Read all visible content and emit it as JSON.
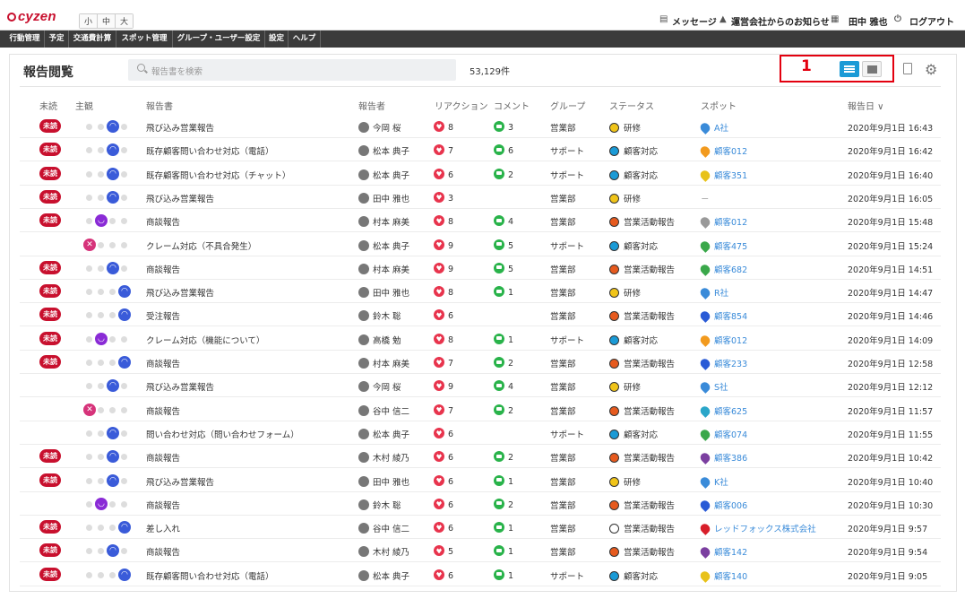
{
  "app": {
    "logo": "cyzen",
    "font_sizes": [
      "小",
      "中",
      "大"
    ]
  },
  "topright": {
    "message": "メッセージ",
    "notice": "運営会社からのお知らせ",
    "user": "田中 雅也",
    "logout": "ログアウト"
  },
  "nav": [
    "行動管理",
    "予定",
    "交通費計算",
    "スポット管理",
    "グループ・ユーザー設定",
    "設定",
    "ヘルプ"
  ],
  "page": {
    "title": "報告閲覧",
    "search_placeholder": "報告書を検索",
    "count": "53,129件",
    "annotation": "1"
  },
  "columns": [
    "未読",
    "主観",
    "報告書",
    "報告者",
    "リアクション",
    "コメント",
    "グループ",
    "ステータス",
    "スポット",
    "報告日 ∨"
  ],
  "colors": {
    "brand": "#c8102e",
    "accent": "#1a9ad6",
    "reaction": "#e8344d",
    "comment": "#29b34a",
    "link": "#3a8bd9"
  },
  "rows": [
    {
      "unread": "未読",
      "mood": "happy",
      "title": "飛び込み営業報告",
      "reporter": "今岡 桜",
      "reaction": "8",
      "comment": "3",
      "group": "営業部",
      "status": "研修",
      "status_icon": "training",
      "spot": "A社",
      "spot_icon": "pin",
      "date": "2020年9月1日 16:43"
    },
    {
      "unread": "未読",
      "mood": "happy",
      "title": "既存顧客問い合わせ対応（電話）",
      "reporter": "松本 典子",
      "reaction": "7",
      "comment": "6",
      "group": "サポート",
      "status": "顧客対応",
      "status_icon": "support",
      "spot": "顧客012",
      "spot_icon": "orange",
      "date": "2020年9月1日 16:42"
    },
    {
      "unread": "未読",
      "mood": "happy",
      "title": "既存顧客問い合わせ対応（チャット）",
      "reporter": "松本 典子",
      "reaction": "6",
      "comment": "2",
      "group": "サポート",
      "status": "顧客対応",
      "status_icon": "support",
      "spot": "顧客351",
      "spot_icon": "yellow",
      "date": "2020年9月1日 16:40"
    },
    {
      "unread": "未読",
      "mood": "happy",
      "title": "飛び込み営業報告",
      "reporter": "田中 雅也",
      "reaction": "3",
      "comment": "",
      "group": "営業部",
      "status": "研修",
      "status_icon": "training",
      "spot": "－",
      "spot_icon": "",
      "date": "2020年9月1日 16:05"
    },
    {
      "unread": "未読",
      "mood": "sad",
      "title": "商談報告",
      "reporter": "村本 麻美",
      "reaction": "8",
      "comment": "4",
      "group": "営業部",
      "status": "営業活動報告",
      "status_icon": "sales",
      "spot": "顧客012",
      "spot_icon": "grey",
      "date": "2020年9月1日 15:48"
    },
    {
      "unread": "",
      "mood": "angry",
      "title": "クレーム対応（不具合発生）",
      "reporter": "松本 典子",
      "reaction": "9",
      "comment": "5",
      "group": "サポート",
      "status": "顧客対応",
      "status_icon": "support",
      "spot": "顧客475",
      "spot_icon": "green",
      "date": "2020年9月1日 15:24"
    },
    {
      "unread": "未読",
      "mood": "happy",
      "title": "商談報告",
      "reporter": "村本 麻美",
      "reaction": "9",
      "comment": "5",
      "group": "営業部",
      "status": "営業活動報告",
      "status_icon": "sales",
      "spot": "顧客682",
      "spot_icon": "green",
      "date": "2020年9月1日 14:51"
    },
    {
      "unread": "未読",
      "mood": "joy",
      "title": "飛び込み営業報告",
      "reporter": "田中 雅也",
      "reaction": "8",
      "comment": "1",
      "group": "営業部",
      "status": "研修",
      "status_icon": "training",
      "spot": "R社",
      "spot_icon": "pin",
      "date": "2020年9月1日 14:47"
    },
    {
      "unread": "未読",
      "mood": "joy",
      "title": "受注報告",
      "reporter": "鈴木 聡",
      "reaction": "6",
      "comment": "",
      "group": "営業部",
      "status": "営業活動報告",
      "status_icon": "sales",
      "spot": "顧客854",
      "spot_icon": "blue",
      "date": "2020年9月1日 14:46"
    },
    {
      "unread": "未読",
      "mood": "sad",
      "title": "クレーム対応（機能について）",
      "reporter": "高橋 勉",
      "reaction": "8",
      "comment": "1",
      "group": "サポート",
      "status": "顧客対応",
      "status_icon": "support",
      "spot": "顧客012",
      "spot_icon": "orange",
      "date": "2020年9月1日 14:09"
    },
    {
      "unread": "未読",
      "mood": "joy",
      "title": "商談報告",
      "reporter": "村本 麻美",
      "reaction": "7",
      "comment": "2",
      "group": "営業部",
      "status": "営業活動報告",
      "status_icon": "sales",
      "spot": "顧客233",
      "spot_icon": "blue",
      "date": "2020年9月1日 12:58"
    },
    {
      "unread": "",
      "mood": "happy",
      "title": "飛び込み営業報告",
      "reporter": "今岡 桜",
      "reaction": "9",
      "comment": "4",
      "group": "営業部",
      "status": "研修",
      "status_icon": "training",
      "spot": "S社",
      "spot_icon": "pin",
      "date": "2020年9月1日 12:12"
    },
    {
      "unread": "",
      "mood": "angry",
      "title": "商談報告",
      "reporter": "谷中 信二",
      "reaction": "7",
      "comment": "2",
      "group": "営業部",
      "status": "営業活動報告",
      "status_icon": "sales",
      "spot": "顧客625",
      "spot_icon": "teal",
      "date": "2020年9月1日 11:57"
    },
    {
      "unread": "",
      "mood": "happy",
      "title": "問い合わせ対応（問い合わせフォーム）",
      "reporter": "松本 典子",
      "reaction": "6",
      "comment": "",
      "group": "サポート",
      "status": "顧客対応",
      "status_icon": "support",
      "spot": "顧客074",
      "spot_icon": "green",
      "date": "2020年9月1日 11:55"
    },
    {
      "unread": "未読",
      "mood": "happy",
      "title": "商談報告",
      "reporter": "木村 綾乃",
      "reaction": "6",
      "comment": "2",
      "group": "営業部",
      "status": "営業活動報告",
      "status_icon": "sales",
      "spot": "顧客386",
      "spot_icon": "purple",
      "date": "2020年9月1日 10:42"
    },
    {
      "unread": "未読",
      "mood": "happy",
      "title": "飛び込み営業報告",
      "reporter": "田中 雅也",
      "reaction": "6",
      "comment": "1",
      "group": "営業部",
      "status": "研修",
      "status_icon": "training",
      "spot": "K社",
      "spot_icon": "pin",
      "date": "2020年9月1日 10:40"
    },
    {
      "unread": "",
      "mood": "sad",
      "title": "商談報告",
      "reporter": "鈴木 聡",
      "reaction": "6",
      "comment": "2",
      "group": "営業部",
      "status": "営業活動報告",
      "status_icon": "sales",
      "spot": "顧客006",
      "spot_icon": "blue",
      "date": "2020年9月1日 10:30"
    },
    {
      "unread": "未読",
      "mood": "joy",
      "title": "差し入れ",
      "reporter": "谷中 信二",
      "reaction": "6",
      "comment": "1",
      "group": "営業部",
      "status": "営業活動報告",
      "status_icon": "other",
      "spot": "レッドフォックス株式会社",
      "spot_icon": "red",
      "date": "2020年9月1日 9:57"
    },
    {
      "unread": "未読",
      "mood": "happy",
      "title": "商談報告",
      "reporter": "木村 綾乃",
      "reaction": "5",
      "comment": "1",
      "group": "営業部",
      "status": "営業活動報告",
      "status_icon": "sales",
      "spot": "顧客142",
      "spot_icon": "purple",
      "date": "2020年9月1日 9:54"
    },
    {
      "unread": "未読",
      "mood": "joy",
      "title": "既存顧客問い合わせ対応（電話）",
      "reporter": "松本 典子",
      "reaction": "6",
      "comment": "1",
      "group": "サポート",
      "status": "顧客対応",
      "status_icon": "support",
      "spot": "顧客140",
      "spot_icon": "yellow",
      "date": "2020年9月1日 9:05"
    }
  ]
}
